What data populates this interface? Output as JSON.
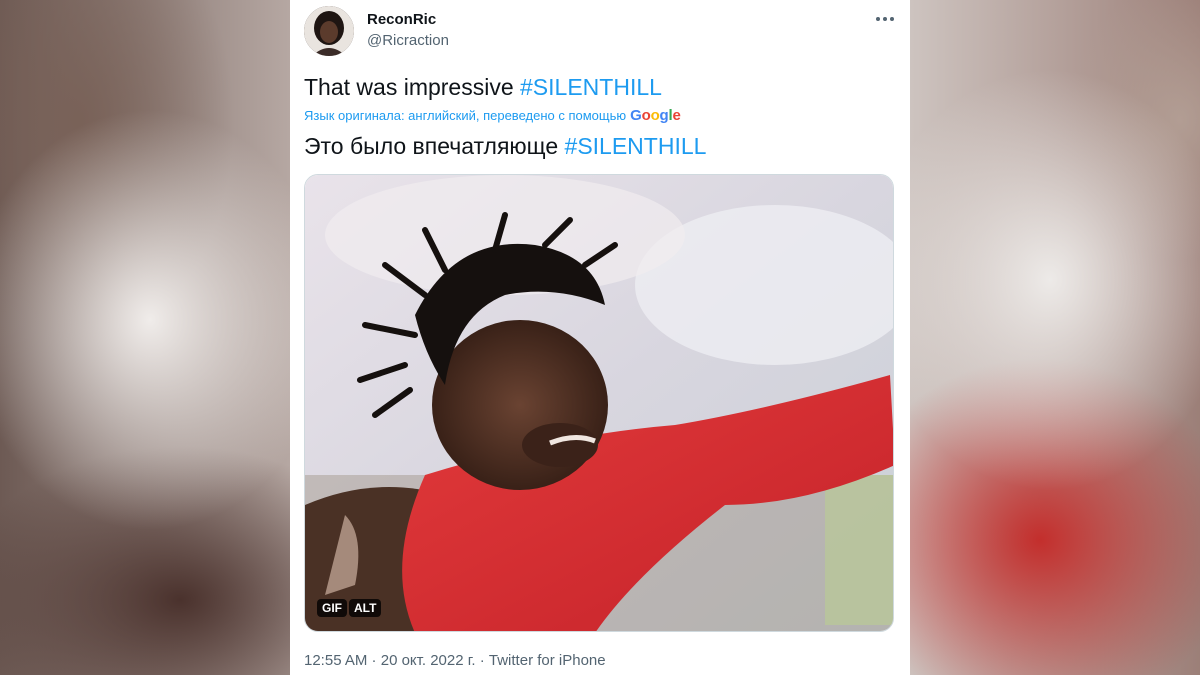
{
  "tweet": {
    "author_name": "ReconRic",
    "author_handle": "@Ricraction",
    "text_plain": "That was impressive ",
    "text_hashtag": "#SILENTHILL",
    "translation_note": "Язык оригинала: английский, переведено с помощью",
    "translation_provider": "Google",
    "translated_plain": "Это было впечатляюще ",
    "translated_hashtag": "#SILENTHILL",
    "media": {
      "badge_gif": "GIF",
      "badge_alt": "ALT"
    },
    "meta": {
      "time": "12:55 AM",
      "date": "20 окт. 2022 г.",
      "source": "Twitter for iPhone",
      "separator": " · "
    }
  },
  "icons": {
    "more": "more-horizontal-icon"
  },
  "colors": {
    "link": "#1d9bf0",
    "text": "#0f1419",
    "muted": "#536471"
  }
}
